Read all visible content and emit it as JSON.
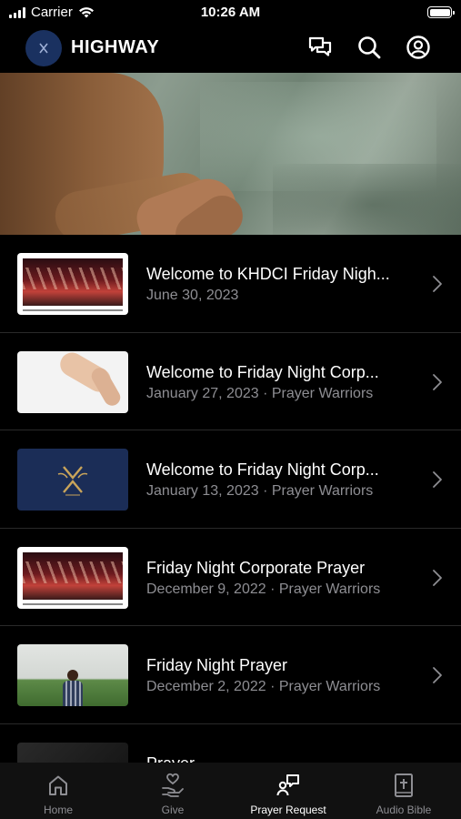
{
  "status_bar": {
    "carrier": "Carrier",
    "time": "10:26 AM"
  },
  "header": {
    "title": "HIGHWAY"
  },
  "items": [
    {
      "title": "Welcome to KHDCI Friday Nigh...",
      "subtitle": "June 30, 2023",
      "thumb": "crowd-worship"
    },
    {
      "title": "Welcome to Friday Night Corp...",
      "subtitle": "January 27, 2023 · Prayer Warriors",
      "thumb": "praying-hands"
    },
    {
      "title": "Welcome to Friday Night Corp...",
      "subtitle": "January 13, 2023 · Prayer Warriors",
      "thumb": "logo"
    },
    {
      "title": "Friday Night Corporate Prayer",
      "subtitle": "December 9, 2022 · Prayer Warriors",
      "thumb": "crowd-worship"
    },
    {
      "title": "Friday Night Prayer",
      "subtitle": "December 2, 2022 · Prayer Warriors",
      "thumb": "man-in-field"
    },
    {
      "title": "Prayer",
      "subtitle": "",
      "thumb": "dark"
    }
  ],
  "tabs": [
    {
      "label": "Home",
      "icon": "home-icon",
      "active": false
    },
    {
      "label": "Give",
      "icon": "give-icon",
      "active": false
    },
    {
      "label": "Prayer Request",
      "icon": "prayer-request-icon",
      "active": true
    },
    {
      "label": "Audio Bible",
      "icon": "bible-icon",
      "active": false
    }
  ]
}
